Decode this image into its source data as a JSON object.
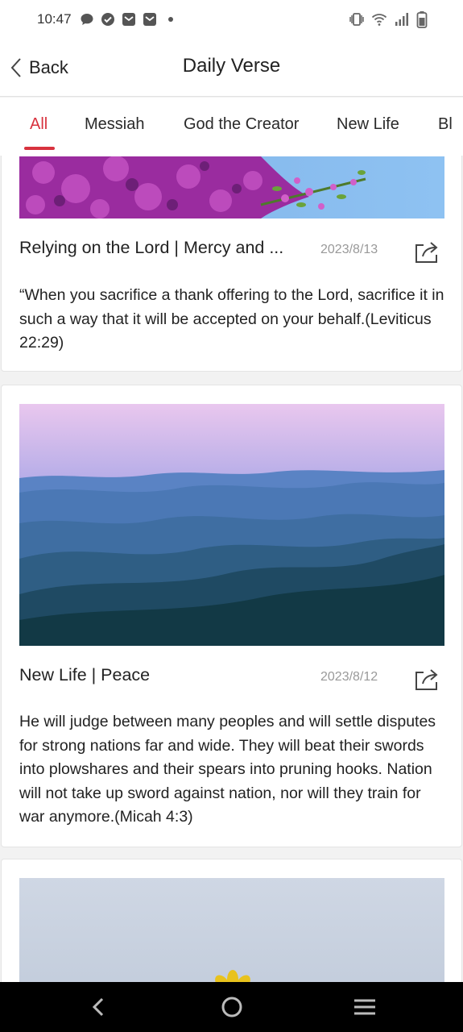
{
  "status_bar": {
    "time": "10:47",
    "left_icons": [
      "chat-bubble-icon",
      "check-circle-icon",
      "mail-icon",
      "mail-icon",
      "dot-icon"
    ],
    "right_icons": [
      "vibrate-icon",
      "wifi-icon",
      "signal-icon",
      "battery-icon"
    ]
  },
  "header": {
    "back_label": "Back",
    "title": "Daily Verse"
  },
  "tabs": {
    "items": [
      "All",
      "Messiah",
      "God the Creator",
      "New Life",
      "Bl"
    ],
    "active_index": 0,
    "accent_color": "#d8323e"
  },
  "cards": [
    {
      "image": "purple-flowers-sky",
      "title": "Relying on the Lord | Mercy and ...",
      "date": "2023/8/13",
      "text": "“When you sacrifice a thank offering to the Lord, sacrifice it in such a way that it will be accepted on your behalf.(Leviticus 22:29)"
    },
    {
      "image": "misty-blue-mountains",
      "title": "New Life | Peace",
      "date": "2023/8/12",
      "text": "He will judge between many peoples and will settle disputes for strong nations far and wide. They will beat their swords into plowshares and their spears into pruning hooks. Nation will not take up sword against nation, nor will they train for war anymore.(Micah 4:3)"
    },
    {
      "image": "pale-sky-yellow-flower"
    }
  ],
  "nav_bar": {
    "icons": [
      "nav-back-icon",
      "nav-home-icon",
      "nav-menu-icon"
    ]
  }
}
